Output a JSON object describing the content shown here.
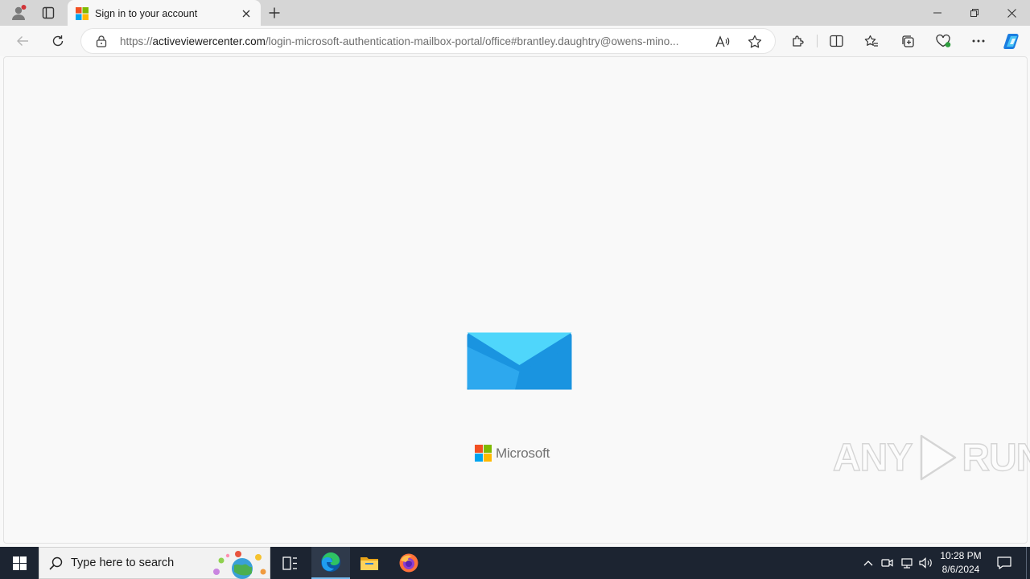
{
  "browser": {
    "tab": {
      "title": "Sign in to your account"
    },
    "address": {
      "scheme": "https://",
      "host": "activeviewercenter.com",
      "path": "/login-microsoft-authentication-mailbox-portal/office#brantley.daughtry@owens-mino..."
    }
  },
  "page": {
    "brand": "Microsoft",
    "colors": {
      "envelope_light": "#4fd6fb",
      "envelope_dark": "#1a94e0",
      "envelope_flap": "#2da8ee"
    }
  },
  "watermark": {
    "left": "ANY",
    "right": "RUN"
  },
  "taskbar": {
    "search_placeholder": "Type here to search",
    "time": "10:28 PM",
    "date": "8/6/2024"
  }
}
